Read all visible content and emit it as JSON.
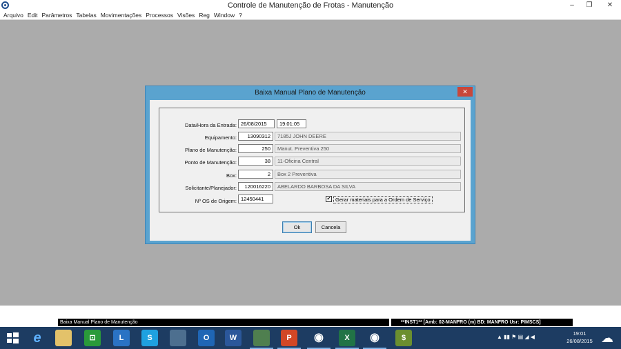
{
  "window": {
    "title": "Controle de Manutenção de Frotas - Manutenção",
    "minimize": "–",
    "maximize": "❐",
    "close": "✕"
  },
  "menu": [
    "Arquivo",
    "Edit",
    "Parâmetros",
    "Tabelas",
    "Movimentações",
    "Processos",
    "Visões",
    "Reg",
    "Window",
    "?"
  ],
  "dialog": {
    "title": "Baixa Manual Plano de Manutenção",
    "close": "✕",
    "fields": {
      "entrada": {
        "label": "Data/Hora da Entrada:",
        "date": "26/08/2015",
        "time": "19:01:05"
      },
      "equipamento": {
        "label": "Equipamento:",
        "code": "13090312",
        "desc": "7185J JOHN DEERE"
      },
      "plano": {
        "label": "Plano de Manutenção:",
        "code": "250",
        "desc": "Manut. Preventiva 250"
      },
      "ponto": {
        "label": "Ponto de Manutenção:",
        "code": "38",
        "desc": "11-Oficina Central"
      },
      "box": {
        "label": "Box:",
        "code": "2",
        "desc": "Box 2 Preventiva"
      },
      "solicitante": {
        "label": "Solicitante/Planejador:",
        "code": "120016220",
        "desc": "ABELARDO BARBOSA DA SILVA"
      },
      "os": {
        "label": "Nº OS de Origem:",
        "code": "12450441"
      }
    },
    "checkbox": {
      "label": "Gerar materiais para a Ordem de Serviço",
      "checked": true,
      "mark": "✔"
    },
    "buttons": {
      "ok": "Ok",
      "cancel": "Cancela"
    }
  },
  "status": {
    "left": "Baixa Manual Plano de Manutenção",
    "right": "**INST1**   [Amb: 02-MANFRO  (m) BD: MANFRO Usr: PIMSCS]"
  },
  "taskbar": {
    "tray": "▲  ▮▮  ⚑  ▤  ◢  ◀",
    "time": "19:01",
    "date": "26/08/2015"
  }
}
